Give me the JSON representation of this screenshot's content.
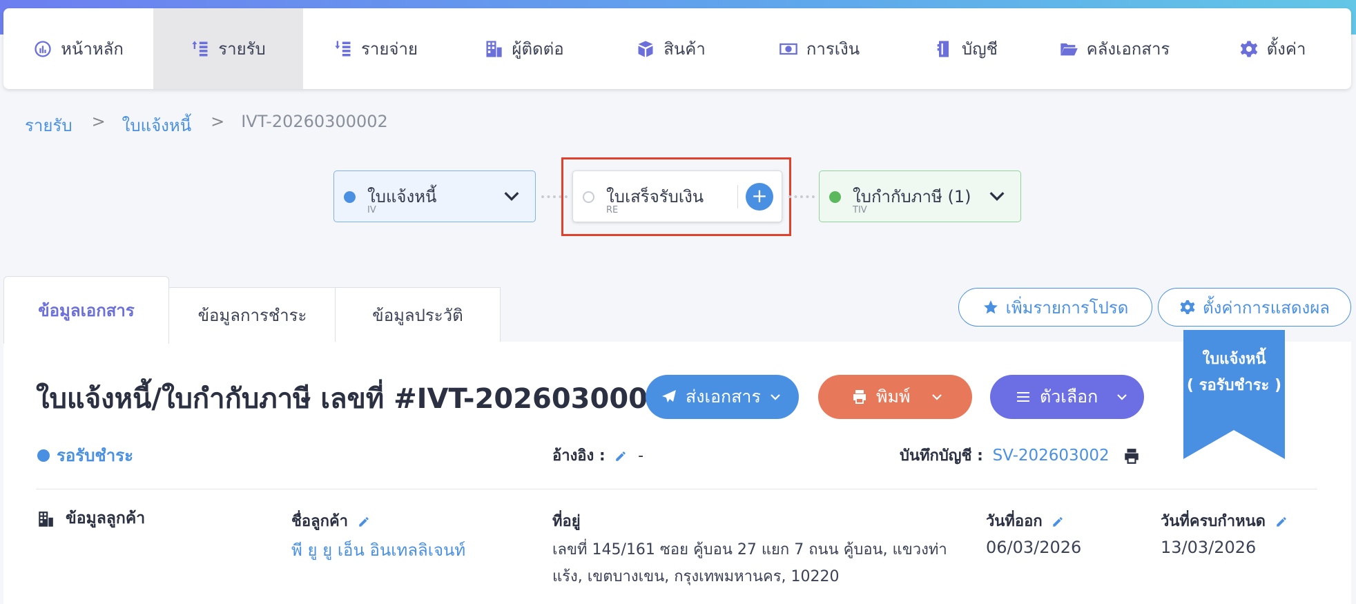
{
  "nav": {
    "items": [
      {
        "label": "หน้าหลัก",
        "icon": "dashboard-icon"
      },
      {
        "label": "รายรับ",
        "icon": "coins-in-icon"
      },
      {
        "label": "รายจ่าย",
        "icon": "coins-out-icon"
      },
      {
        "label": "ผู้ติดต่อ",
        "icon": "building-icon"
      },
      {
        "label": "สินค้า",
        "icon": "box-icon"
      },
      {
        "label": "การเงิน",
        "icon": "money-icon"
      },
      {
        "label": "บัญชี",
        "icon": "ledger-icon"
      },
      {
        "label": "คลังเอกสาร",
        "icon": "folder-icon"
      },
      {
        "label": "ตั้งค่า",
        "icon": "gear-icon"
      }
    ]
  },
  "breadcrumb": {
    "level1": "รายรับ",
    "sep": ">",
    "level2": "ใบแจ้งหนี้",
    "current": "IVT-20260300002"
  },
  "flow": {
    "iv": {
      "title": "ใบแจ้งหนี้",
      "code": "IV",
      "color": "#4a90e2"
    },
    "re": {
      "title": "ใบเสร็จรับเงิน",
      "code": "RE",
      "add": "+"
    },
    "tiv": {
      "title": "ใบกำกับภาษี (1)",
      "code": "TIV",
      "color": "#5cb85c"
    }
  },
  "tabs": {
    "doc": "ข้อมูลเอกสาร",
    "payment": "ข้อมูลการชำระ",
    "history": "ข้อมูลประวัติ"
  },
  "actions_top": {
    "favorite": "เพิ่มรายการโปรด",
    "display_settings": "ตั้งค่าการแสดงผล"
  },
  "ribbon": {
    "line1": "ใบแจ้งหนี้",
    "line2": "( รอรับชำระ )"
  },
  "document": {
    "title": "ใบแจ้งหนี้/ใบกำกับภาษี เลขที่ #IVT-20260300002",
    "send": "ส่งเอกสาร",
    "print": "พิมพ์",
    "options": "ตัวเลือก",
    "status": "รอรับชำระ",
    "reference_label": "อ้างอิง :",
    "reference_value": "-",
    "journal_label": "บันทึกบัญชี :",
    "journal_value": "SV-202603002"
  },
  "customer": {
    "section": "ข้อมูลลูกค้า",
    "name_label": "ชื่อลูกค้า",
    "name": "พี ยู ยู เอ็น อินเทลลิเจนท์",
    "address_label": "ที่อยู่",
    "address_line1": "เลขที่ 145/161 ซอย คู้บอน 27 แยก 7 ถนน คู้บอน, แขวงท่า",
    "address_line2": "แร้ง, เขตบางเขน, กรุงเทพมหานคร, 10220",
    "issue_label": "วันที่ออก",
    "issue_date": "06/03/2026",
    "due_label": "วันที่ครบกำหนด",
    "due_date": "13/03/2026"
  },
  "colors": {
    "accent": "#4a90e2",
    "print": "#e8785a",
    "options": "#6b6fe3",
    "highlight": "#e0412c"
  }
}
